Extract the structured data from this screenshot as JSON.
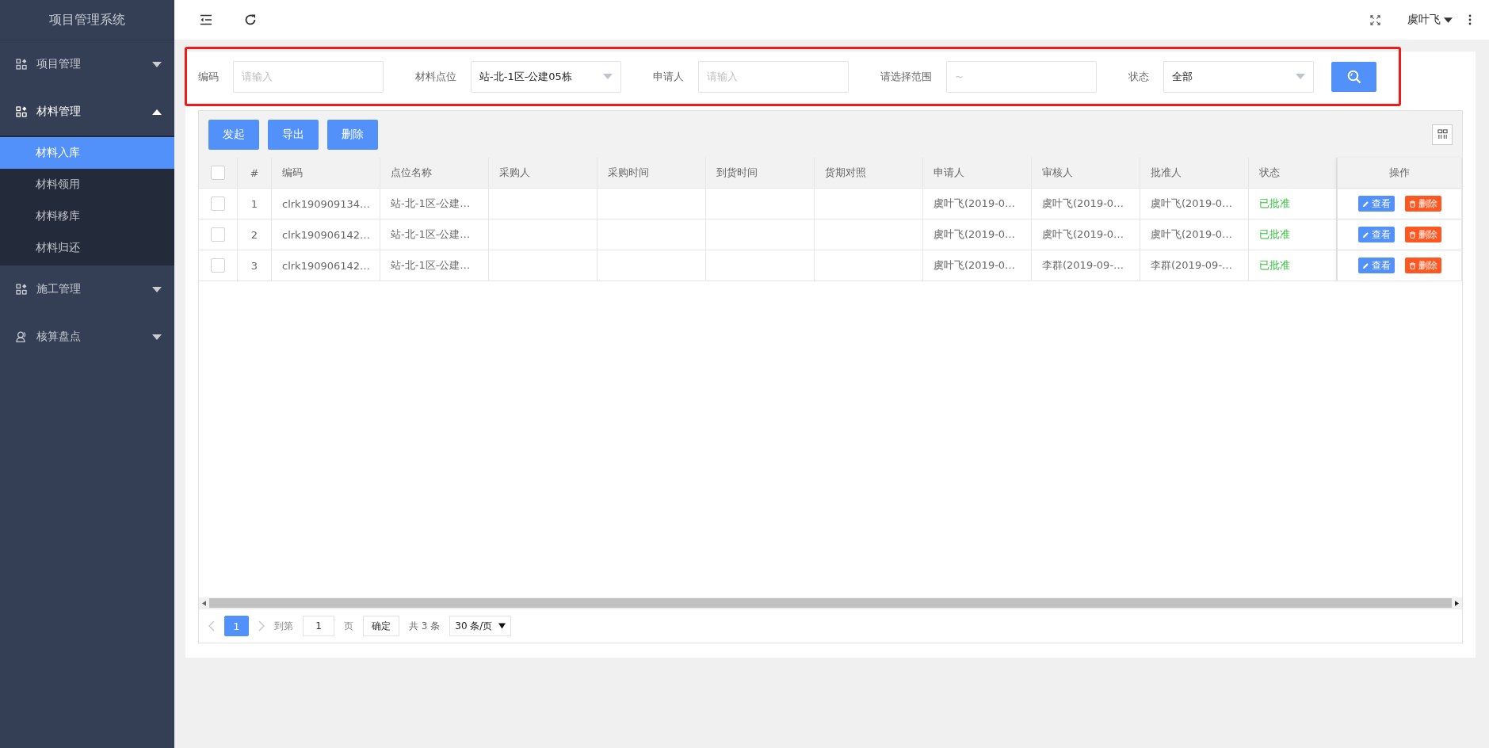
{
  "sidebar": {
    "title": "项目管理系统",
    "menus": [
      {
        "label": "项目管理",
        "kind": "grid",
        "expanded": false
      },
      {
        "label": "材料管理",
        "kind": "grid",
        "expanded": true,
        "children": [
          {
            "label": "材料入库",
            "selected": true
          },
          {
            "label": "材料领用",
            "selected": false
          },
          {
            "label": "材料移库",
            "selected": false
          },
          {
            "label": "材料归还",
            "selected": false
          }
        ]
      },
      {
        "label": "施工管理",
        "kind": "grid",
        "expanded": false
      },
      {
        "label": "核算盘点",
        "kind": "person",
        "expanded": false
      }
    ]
  },
  "topbar": {
    "user": "虞叶飞"
  },
  "filters": [
    {
      "label": "编码",
      "kind": "input",
      "placeholder": "请输入"
    },
    {
      "label": "材料点位",
      "kind": "select",
      "value": "站-北-1区-公建05栋"
    },
    {
      "label": "申请人",
      "kind": "input",
      "placeholder": "请输入"
    },
    {
      "label": "请选择范围",
      "kind": "input",
      "placeholder": "~"
    },
    {
      "label": "状态",
      "kind": "select",
      "value": "全部"
    }
  ],
  "toolbar": {
    "buttons": [
      "发起",
      "导出",
      "删除"
    ]
  },
  "table": {
    "select_all_checked": false,
    "columns": [
      "#",
      "编码",
      "点位名称",
      "采购人",
      "采购时间",
      "到货时间",
      "货期对照",
      "申请人",
      "审核人",
      "批准人",
      "状态",
      "操作"
    ],
    "rows": [
      {
        "checked": false,
        "cells": [
          "1",
          "clrk190909134…",
          "站-北-1区-公建…",
          null,
          null,
          null,
          null,
          "虞叶飞(2019-0…",
          "虞叶飞(2019-0…",
          "虞叶飞(2019-0…",
          "已批准"
        ],
        "actions": [
          {
            "kind": "edit",
            "label": "查看"
          },
          {
            "kind": "delete",
            "label": "删除"
          }
        ]
      },
      {
        "checked": false,
        "cells": [
          "2",
          "clrk190906142…",
          "站-北-1区-公建…",
          null,
          null,
          null,
          null,
          "虞叶飞(2019-0…",
          "虞叶飞(2019-0…",
          "虞叶飞(2019-0…",
          "已批准"
        ],
        "actions": [
          {
            "kind": "edit",
            "label": "查看"
          },
          {
            "kind": "delete",
            "label": "删除"
          }
        ]
      },
      {
        "checked": false,
        "cells": [
          "3",
          "clrk190906142…",
          "站-北-1区-公建…",
          null,
          null,
          null,
          null,
          "虞叶飞(2019-0…",
          "李群(2019-09-…",
          "李群(2019-09-…",
          "已批准"
        ],
        "actions": [
          {
            "kind": "edit",
            "label": "查看"
          },
          {
            "kind": "delete",
            "label": "删除"
          }
        ]
      }
    ]
  },
  "pagination": {
    "pages": [
      {
        "label": "1",
        "selected": true
      }
    ],
    "goto_label": "到第",
    "goto_value": "1",
    "page_unit": "页",
    "confirm": "确定",
    "total": "共 3 条",
    "page_size": "30 条/页"
  }
}
